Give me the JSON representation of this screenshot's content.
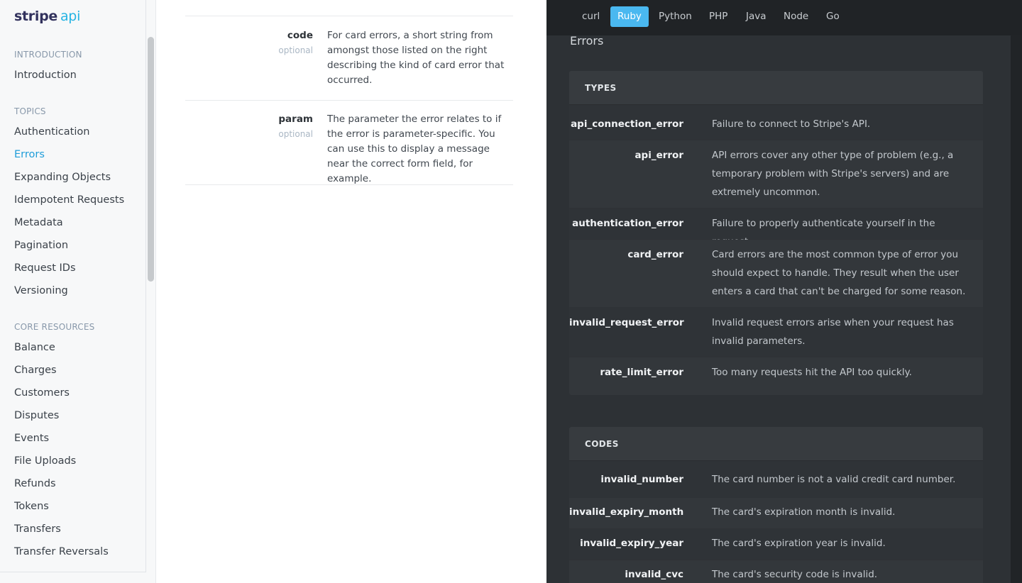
{
  "logo": {
    "brand": "stripe",
    "suffix": "api"
  },
  "sidebar": {
    "sections": [
      {
        "title": "INTRODUCTION",
        "items": [
          {
            "label": "Introduction",
            "active": false
          }
        ]
      },
      {
        "title": "TOPICS",
        "items": [
          {
            "label": "Authentication",
            "active": false
          },
          {
            "label": "Errors",
            "active": true
          },
          {
            "label": "Expanding Objects",
            "active": false
          },
          {
            "label": "Idempotent Requests",
            "active": false
          },
          {
            "label": "Metadata",
            "active": false
          },
          {
            "label": "Pagination",
            "active": false
          },
          {
            "label": "Request IDs",
            "active": false
          },
          {
            "label": "Versioning",
            "active": false
          }
        ]
      },
      {
        "title": "CORE RESOURCES",
        "items": [
          {
            "label": "Balance",
            "active": false
          },
          {
            "label": "Charges",
            "active": false
          },
          {
            "label": "Customers",
            "active": false
          },
          {
            "label": "Disputes",
            "active": false
          },
          {
            "label": "Events",
            "active": false
          },
          {
            "label": "File Uploads",
            "active": false
          },
          {
            "label": "Refunds",
            "active": false
          },
          {
            "label": "Tokens",
            "active": false
          },
          {
            "label": "Transfers",
            "active": false
          },
          {
            "label": "Transfer Reversals",
            "active": false
          }
        ]
      }
    ]
  },
  "params": [
    {
      "name": "code",
      "optional": "optional",
      "description": "For card errors, a short string from amongst those listed on the right describing the kind of card error that occurred."
    },
    {
      "name": "param",
      "optional": "optional",
      "description": "The parameter the error relates to if the error is parameter-specific. You can use this to display a message near the correct form field, for example."
    }
  ],
  "languages": [
    {
      "label": "curl",
      "active": false
    },
    {
      "label": "Ruby",
      "active": true
    },
    {
      "label": "Python",
      "active": false
    },
    {
      "label": "PHP",
      "active": false
    },
    {
      "label": "Java",
      "active": false
    },
    {
      "label": "Node",
      "active": false
    },
    {
      "label": "Go",
      "active": false
    }
  ],
  "right_heading": "Errors",
  "types_table": {
    "title": "TYPES",
    "rows": [
      {
        "key": "api_connection_error",
        "value": "Failure to connect to Stripe's API."
      },
      {
        "key": "api_error",
        "value": "API errors cover any other type of problem (e.g., a temporary problem with Stripe's servers) and are extremely uncommon."
      },
      {
        "key": "authentication_error",
        "value": "Failure to properly authenticate yourself in the request."
      },
      {
        "key": "card_error",
        "value": "Card errors are the most common type of error you should expect to handle. They result when the user enters a card that can't be charged for some reason."
      },
      {
        "key": "invalid_request_error",
        "value": "Invalid request errors arise when your request has invalid parameters."
      },
      {
        "key": "rate_limit_error",
        "value": "Too many requests hit the API too quickly."
      }
    ]
  },
  "codes_table": {
    "title": "CODES",
    "rows": [
      {
        "key": "invalid_number",
        "value": "The card number is not a valid credit card number."
      },
      {
        "key": "invalid_expiry_month",
        "value": "The card's expiration month is invalid."
      },
      {
        "key": "invalid_expiry_year",
        "value": "The card's expiration year is invalid."
      },
      {
        "key": "invalid_cvc",
        "value": "The card's security code is invalid."
      }
    ]
  }
}
